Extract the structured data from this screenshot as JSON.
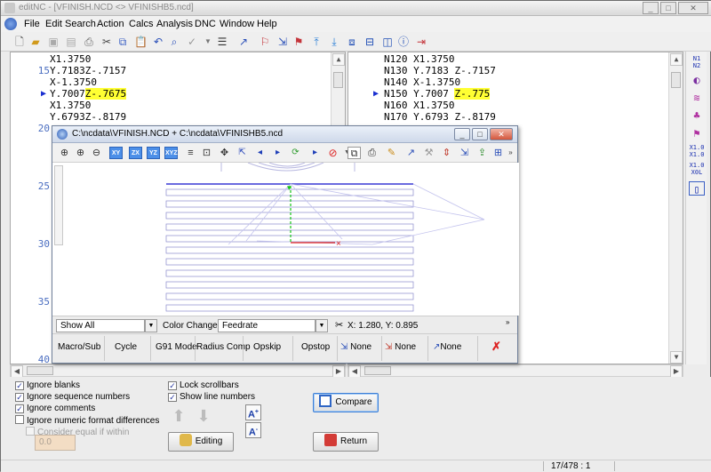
{
  "window": {
    "title": "editNC - [VFINISH.NCD  <>  VFINISHB5.ncd]",
    "controls": [
      "_",
      "□",
      "✕"
    ]
  },
  "menu": {
    "items": [
      "File",
      "Edit",
      "Search",
      "Action",
      "Calcs",
      "Analysis",
      "DNC",
      "Window",
      "Help"
    ]
  },
  "mdi_controls": [
    "_",
    "▫",
    "×"
  ],
  "left_pane": {
    "line_numbers": [
      "15",
      "20",
      "25",
      "30",
      "35",
      "40"
    ],
    "lines": [
      {
        "text": "X1.3750"
      },
      {
        "text": "Y.7183Z-.7157"
      },
      {
        "text": "X-1.3750"
      },
      {
        "text": "Y.7007",
        "highlight": "Z-.7675",
        "current": true
      },
      {
        "text": "X1.3750"
      },
      {
        "text": "Y.6793Z-.8179"
      }
    ]
  },
  "right_pane": {
    "lines": [
      {
        "text": "N120 X1.3750"
      },
      {
        "text": "N130 Y.7183 Z-.7157"
      },
      {
        "text": "N140 X-1.3750"
      },
      {
        "text": "N150 Y.7007 ",
        "highlight": "Z-.775",
        "current": true
      },
      {
        "text": "N160 X1.3750"
      },
      {
        "text": "N170 Y.6793 Z-.8179"
      }
    ]
  },
  "right_toolbar": [
    "N1\nN2",
    "◐",
    "≋",
    "♣",
    "⚑",
    "X1.0\nX1.0",
    "X1.0\nX0L",
    "▯"
  ],
  "viewer": {
    "title": "C:\\ncdata\\VFINISH.NCD + C:\\ncdata\\VFINISHB5.ncd",
    "view_buttons": [
      "XY",
      "ZX",
      "YZ",
      "XYZ"
    ],
    "show_label": "Show All",
    "color_change_label": "Color Change:",
    "color_change_value": "Feedrate",
    "coords": "X: 1.280,  Y: 0.895",
    "filter_buttons": [
      {
        "label": "Macro/Sub"
      },
      {
        "label": "Cycle"
      },
      {
        "label": "G91 Mode"
      },
      {
        "label": "Radius Comp"
      },
      {
        "label": "Opskip"
      },
      {
        "label": "Opstop"
      },
      {
        "label": "None",
        "icon": "arrow-icon"
      },
      {
        "label": "None",
        "icon": "arrow-icon"
      },
      {
        "label": "None",
        "icon": "arrow-icon"
      }
    ]
  },
  "options": {
    "left": [
      {
        "label": "Ignore blanks",
        "checked": true
      },
      {
        "label": "Ignore sequence numbers",
        "checked": true
      },
      {
        "label": "Ignore comments",
        "checked": true
      },
      {
        "label": "Ignore numeric format differences",
        "checked": false
      },
      {
        "label": "Consider equal if within",
        "checked": false,
        "disabled": true
      }
    ],
    "tolerance_value": "0.0",
    "middle": [
      {
        "label": "Lock scrollbars",
        "checked": true
      },
      {
        "label": "Show line numbers",
        "checked": true
      }
    ]
  },
  "buttons": {
    "editing": "Editing",
    "compare": "Compare",
    "return": "Return"
  },
  "status": {
    "position": "17/478 : 1"
  }
}
